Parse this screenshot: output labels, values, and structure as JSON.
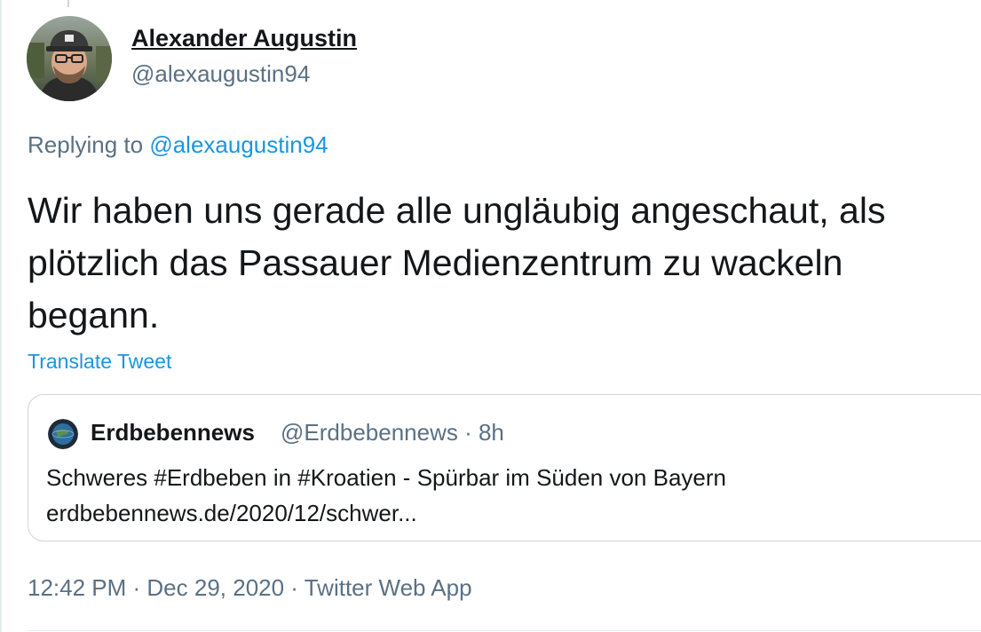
{
  "tweet": {
    "author": {
      "name": "Alexander Augustin",
      "handle": "@alexaugustin94"
    },
    "replying": {
      "prefix": "Replying to ",
      "mention": "@alexaugustin94"
    },
    "text": "Wir haben uns gerade alle ungläubig angeschaut, als plötzlich das Passauer Medienzentrum zu wackeln begann.",
    "translate_label": "Translate Tweet",
    "quoted": {
      "name": "Erdbebennews",
      "handle_time": "@Erdbebennews · 8h",
      "text_line1": "Schweres #Erdbeben in #Kroatien - Spürbar im Süden von Bayern",
      "text_line2": "erdbebennews.de/2020/12/schwer..."
    },
    "meta": {
      "time": "12:42 PM",
      "sep1": " · ",
      "date": "Dec 29, 2020",
      "sep2": " · ",
      "source": "Twitter Web App"
    }
  },
  "colors": {
    "text": "#14171a",
    "secondary": "#5b7083",
    "link": "#1b95e0",
    "border": "#ccd6dd"
  }
}
